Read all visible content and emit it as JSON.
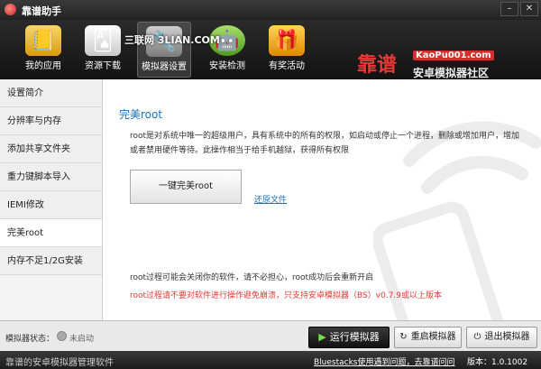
{
  "window": {
    "title": "靠谱助手"
  },
  "watermark": "三联网 3LIAN.COM",
  "toolbar": [
    {
      "label": "我的应用",
      "icon": "book-icon",
      "color": "#f5c542"
    },
    {
      "label": "资源下载",
      "icon": "cards-icon",
      "color": "#e8e8e8"
    },
    {
      "label": "模拟器设置",
      "icon": "tools-icon",
      "color": "#9e9e9e"
    },
    {
      "label": "安装检测",
      "icon": "android-icon",
      "color": "#7cc242"
    },
    {
      "label": "有奖活动",
      "icon": "gift-icon",
      "color": "#f0a020"
    }
  ],
  "brand": {
    "big": "靠谱",
    "url": "KaoPu001.com",
    "sub": "安卓模拟器社区"
  },
  "sidebar": {
    "items": [
      "设置简介",
      "分辨率与内存",
      "添加共享文件夹",
      "重力键脚本导入",
      "IEMI修改",
      "完美root",
      "内存不足1/2G安装"
    ],
    "active": 5
  },
  "main": {
    "title": "完美root",
    "desc": "root是对系统中唯一的超级用户，具有系统中的所有的权限，如启动或停止一个进程，删除或增加用户，增加或者禁用硬件等待。此操作相当于给手机越狱，获得所有权限",
    "root_button": "一键完美root",
    "restore_link": "还原文件",
    "note1": "root过程可能会关闭你的软件，请不必担心，root成功后会重新开启",
    "note2": "root过程请不要对软件进行操作避免崩溃，只支持安卓模拟器（BS）v0.7.9或以上版本"
  },
  "status": {
    "label": "模拟器状态：",
    "value": "未启动"
  },
  "buttons": {
    "run": "运行模拟器",
    "restart": "重启模拟器",
    "exit": "退出模拟器"
  },
  "footer": {
    "slogan": "靠谱的安卓模拟器管理软件",
    "link": "Bluestacks使用遇到问题，去靠谱问问",
    "version": "版本：1.0.1002"
  }
}
